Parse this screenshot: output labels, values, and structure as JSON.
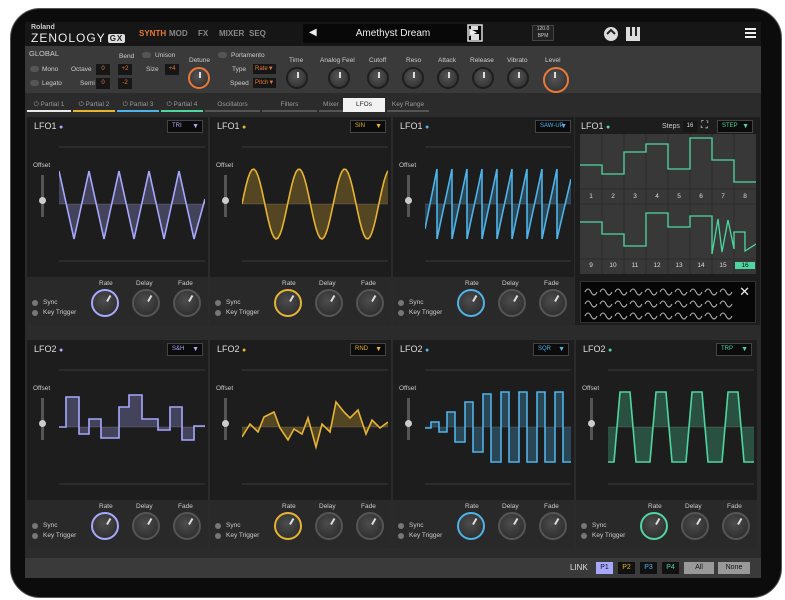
{
  "app": {
    "brand": "Roland",
    "product": "ZENOLOGY",
    "edition": "GX"
  },
  "top_nav": [
    "SYNTH",
    "MOD",
    "FX",
    "MIXER",
    "SEQ"
  ],
  "preset_name": "Amethyst Dream",
  "tempo": {
    "value": "120.0",
    "unit": "BPM"
  },
  "global": {
    "title": "GLOBAL",
    "mono": "Mono",
    "legato": "Legato",
    "unison": "Unison",
    "octave_label": "Octave",
    "octave": "0",
    "bend_label": "Bend",
    "bend_up": "+2",
    "bend_down": "-2",
    "semi_label": "Semi",
    "semi": "0",
    "size_label": "Size",
    "size": "+4",
    "detune": "Detune",
    "portamento": "Portamento",
    "type_label": "Type",
    "type_value": "Rate",
    "speed_label": "Speed",
    "speed_value": "Pitch",
    "time": "Time"
  },
  "macro_knobs": [
    "Analog Feel",
    "Cutoff",
    "Reso",
    "Attack",
    "Release",
    "Vibrato",
    "Level"
  ],
  "tabs": [
    "Partial 1",
    "Partial 2",
    "Partial 3",
    "Partial 4",
    "Oscillators",
    "Filters",
    "Mixer",
    "LFOs",
    "Key Range"
  ],
  "colors": {
    "p1": "#a8a8ff",
    "p2": "#e6b435",
    "p3": "#4fb3e8",
    "p4": "#4fd6a0",
    "accent": "#e8793a"
  },
  "panel_labels": {
    "offset": "Offset",
    "sync": "Sync",
    "key_trigger": "Key Trigger",
    "rate": "Rate",
    "delay": "Delay",
    "fade": "Fade"
  },
  "lfo1": [
    {
      "title": "LFO1",
      "shape": "TRI",
      "color": "#a8a8ff"
    },
    {
      "title": "LFO1",
      "shape": "SIN",
      "color": "#e6b435"
    },
    {
      "title": "LFO1",
      "shape": "SAW-UP",
      "color": "#4fb3e8"
    }
  ],
  "lfo1_step": {
    "title": "LFO1",
    "steps_label": "Steps",
    "steps_value": "16",
    "shape": "STEP",
    "numbers": [
      "1",
      "2",
      "3",
      "4",
      "5",
      "6",
      "7",
      "8",
      "9",
      "10",
      "11",
      "12",
      "13",
      "14",
      "15",
      "16"
    ],
    "active_step": "16"
  },
  "lfo2": [
    {
      "title": "LFO2",
      "shape": "S&H",
      "color": "#a8a8ff"
    },
    {
      "title": "LFO2",
      "shape": "RND",
      "color": "#e6b435"
    },
    {
      "title": "LFO2",
      "shape": "SQR",
      "color": "#4fb3e8"
    },
    {
      "title": "LFO2",
      "shape": "TRP",
      "color": "#4fd6a0"
    }
  ],
  "link_bar": {
    "label": "LINK",
    "buttons": [
      "P1",
      "P2",
      "P3",
      "P4",
      "All",
      "None"
    ]
  }
}
